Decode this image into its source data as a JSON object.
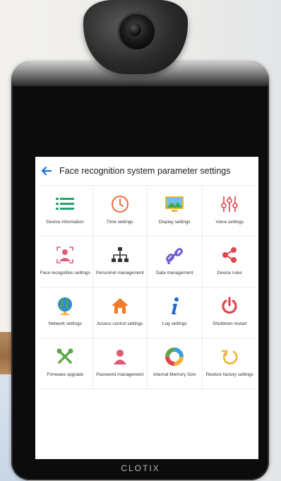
{
  "screen": {
    "title": "Face recognition system parameter settings",
    "items": [
      {
        "label": "Device information",
        "icon": "list-icon",
        "color": "#20a56e"
      },
      {
        "label": "Time settings",
        "icon": "clock-icon",
        "color": "#ef6b3d"
      },
      {
        "label": "Display settings",
        "icon": "display-icon",
        "color": "#e6b83a"
      },
      {
        "label": "Voice settings",
        "icon": "sliders-icon",
        "color": "#e0545a"
      },
      {
        "label": "Face recognition settings",
        "icon": "face-user-icon",
        "color": "#e05a76"
      },
      {
        "label": "Personnel management",
        "icon": "org-chart-icon",
        "color": "#333333"
      },
      {
        "label": "Data management",
        "icon": "link-icon",
        "color": "#6f5bd1"
      },
      {
        "label": "Device rules",
        "icon": "share-icon",
        "color": "#e0454e"
      },
      {
        "label": "Network settings",
        "icon": "globe-icon",
        "color": "#2c8bd6"
      },
      {
        "label": "Access control settings",
        "icon": "home-icon",
        "color": "#f07a2a"
      },
      {
        "label": "Log settings",
        "icon": "info-icon",
        "color": "#2469c9"
      },
      {
        "label": "Shutdown restart",
        "icon": "power-icon",
        "color": "#e0454e"
      },
      {
        "label": "Firmware upgrade",
        "icon": "tools-icon",
        "color": "#5aa64a"
      },
      {
        "label": "Password management",
        "icon": "user-lock-icon",
        "color": "#e05a76"
      },
      {
        "label": "Internal Memory Size",
        "icon": "pie-ring-icon",
        "color": "#3aa0e0"
      },
      {
        "label": "Restore factory settings",
        "icon": "restore-icon",
        "color": "#f0b23a"
      }
    ]
  },
  "brand": "CLOTIX"
}
